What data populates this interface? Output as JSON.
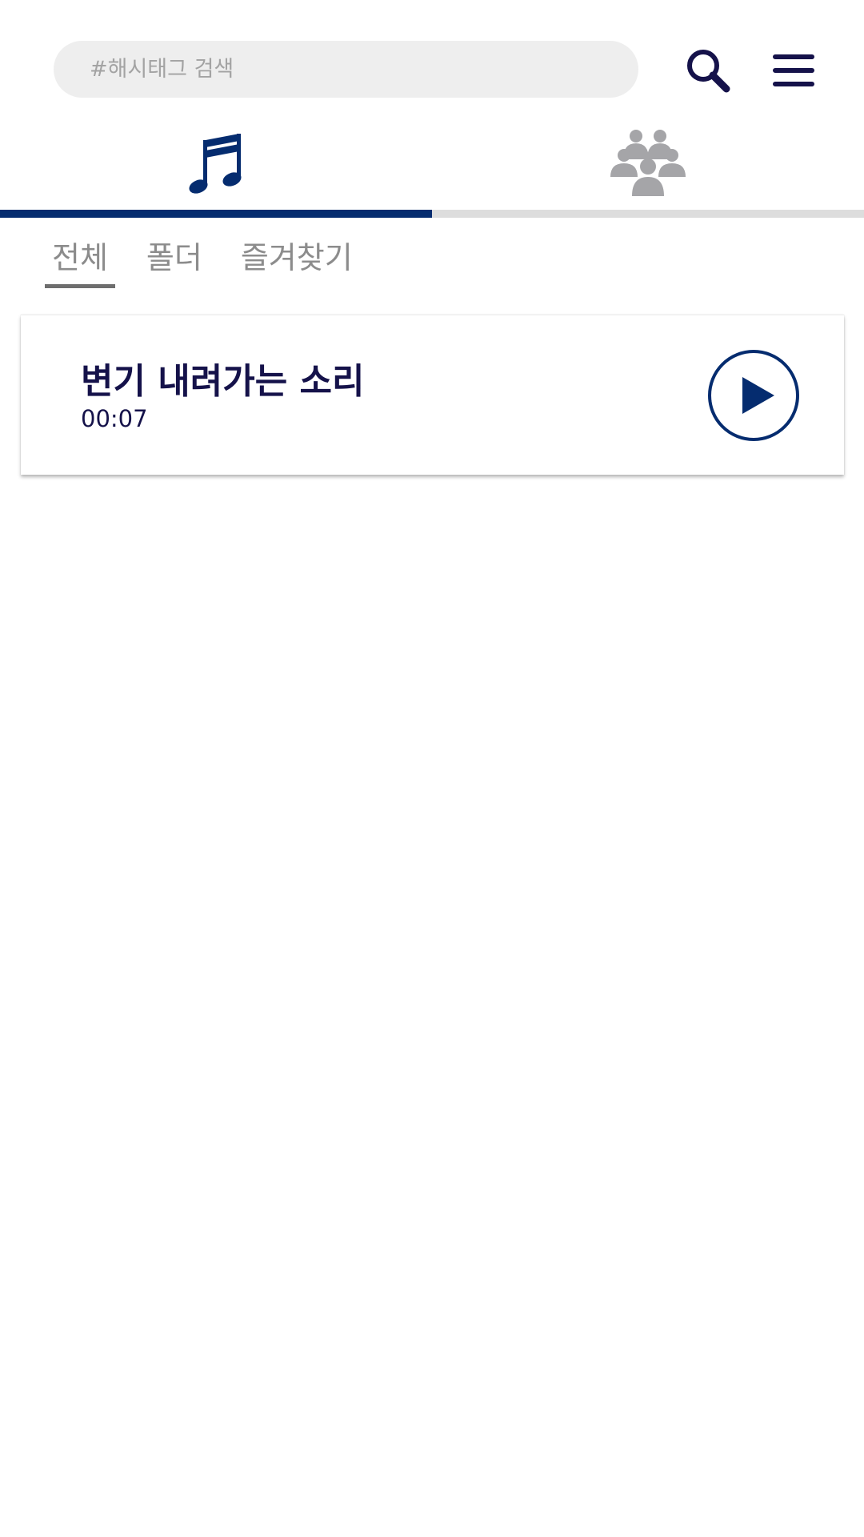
{
  "search": {
    "placeholder": "#해시태그 검색"
  },
  "header": {
    "search_icon": "search-icon",
    "menu_icon": "menu-icon"
  },
  "main_tabs": [
    {
      "icon": "music-note-icon",
      "active": true
    },
    {
      "icon": "group-icon",
      "active": false
    }
  ],
  "sub_tabs": [
    {
      "label": "전체",
      "active": true
    },
    {
      "label": "폴더",
      "active": false
    },
    {
      "label": "즐겨찾기",
      "active": false
    }
  ],
  "items": [
    {
      "title": "변기 내려가는 소리",
      "duration": "00:07",
      "action_icon": "play-icon"
    }
  ],
  "colors": {
    "accent": "#052c6f",
    "title_text": "#15124a",
    "inactive_icon": "#a5a5a8",
    "inactive_text": "#8c8c8c",
    "search_bg": "#eeeeee"
  }
}
